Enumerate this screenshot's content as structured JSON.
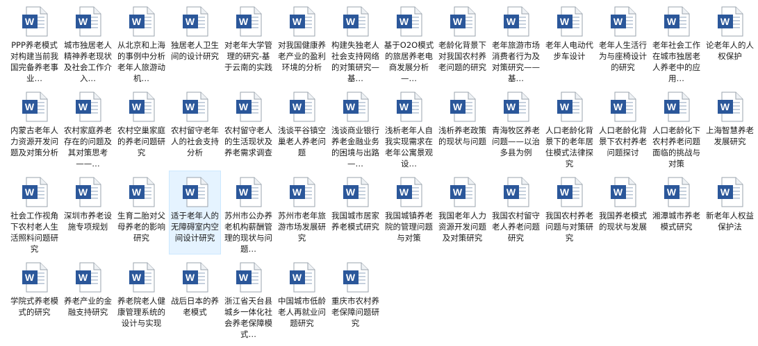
{
  "colors": {
    "word_blue": "#2b579a",
    "doc_border": "#9aa3ad",
    "selection_bg": "#e5f3ff",
    "selection_border": "#cce8ff"
  },
  "icon": {
    "name": "word-document-icon",
    "letter": "W"
  },
  "selected_index": 31,
  "files": [
    "PPP养老模式对构建当前我国完备养老事业…",
    "城市独居老人精神养老现状及社会工作介入…",
    "从北京和上海的事例中分析老年人旅游动机…",
    "独居老人卫生间的设计研究",
    "对老年大学管理的研究-基于云南的实践",
    "对我国健康养老产业的盈利环境的分析",
    "构建失独老人社会支持网络的对策研究—基…",
    "基于O2O模式的旅居养老电商发展分析—…",
    "老龄化背景下对我国农村养老问题的研究",
    "老年旅游市场消费者行为及对策研究——基…",
    "老年人电动代步车设计",
    "老年人生活行为与座椅设计的研究",
    "老年社会工作在城市独居老人养老中的应用…",
    "论老年人的人权保护",
    "内蒙古老年人力资源开发问题及对策分析",
    "农村家庭养老存在的问题及其对策思考——…",
    "农村空巢家庭的养老问题研究",
    "农村留守老年人的社会支持分析",
    "农村留守老人的生活现状及养老需求调查",
    "浅谈平谷镇空巢老人养老问题",
    "浅谈商业银行养老金融业务的困境与出路—…",
    "浅析老年人自我实现需求在老年公寓景观设…",
    "浅析养老政策的现状与问题",
    "青海牧区养老问题——以治多县为例",
    "人口老龄化背景下的老年居住模式法律探究",
    "人口老龄化背景下农村养老问题探讨",
    "人口老龄化下农村养老问题面临的挑战与对策",
    "上海智慧养老发展研究",
    "社会工作视角下农村老人生活照料问题研究",
    "深圳市养老设施专项规划",
    "生育二胎对父母养老的影响研究",
    "适于老年人的无障碍室内空间设计研究",
    "苏州市公办养老机构薪酬管理的现状与问题…",
    "苏州市老年旅游市场发展研究",
    "我国城市居家养老模式研究",
    "我国城镇养老院的管理问题与对策",
    "我国老年人力资源开发问题及对策研究",
    "我国农村留守老人养老问题研究",
    "我国农村养老问题与对策研究",
    "我国养老模式的现状与发展",
    "湘潭城市养老模式研究",
    "新老年人权益保护法",
    "学院式养老模式的研究",
    "养老产业的金融支持研究",
    "养老院老人健康管理系统的设计与实现",
    "战后日本的养老模式",
    "浙江省天台县城乡一体化社会养老保障模式…",
    "中国城市低龄老人再就业问题研究",
    "重庆市农村养老保障问题研究"
  ]
}
